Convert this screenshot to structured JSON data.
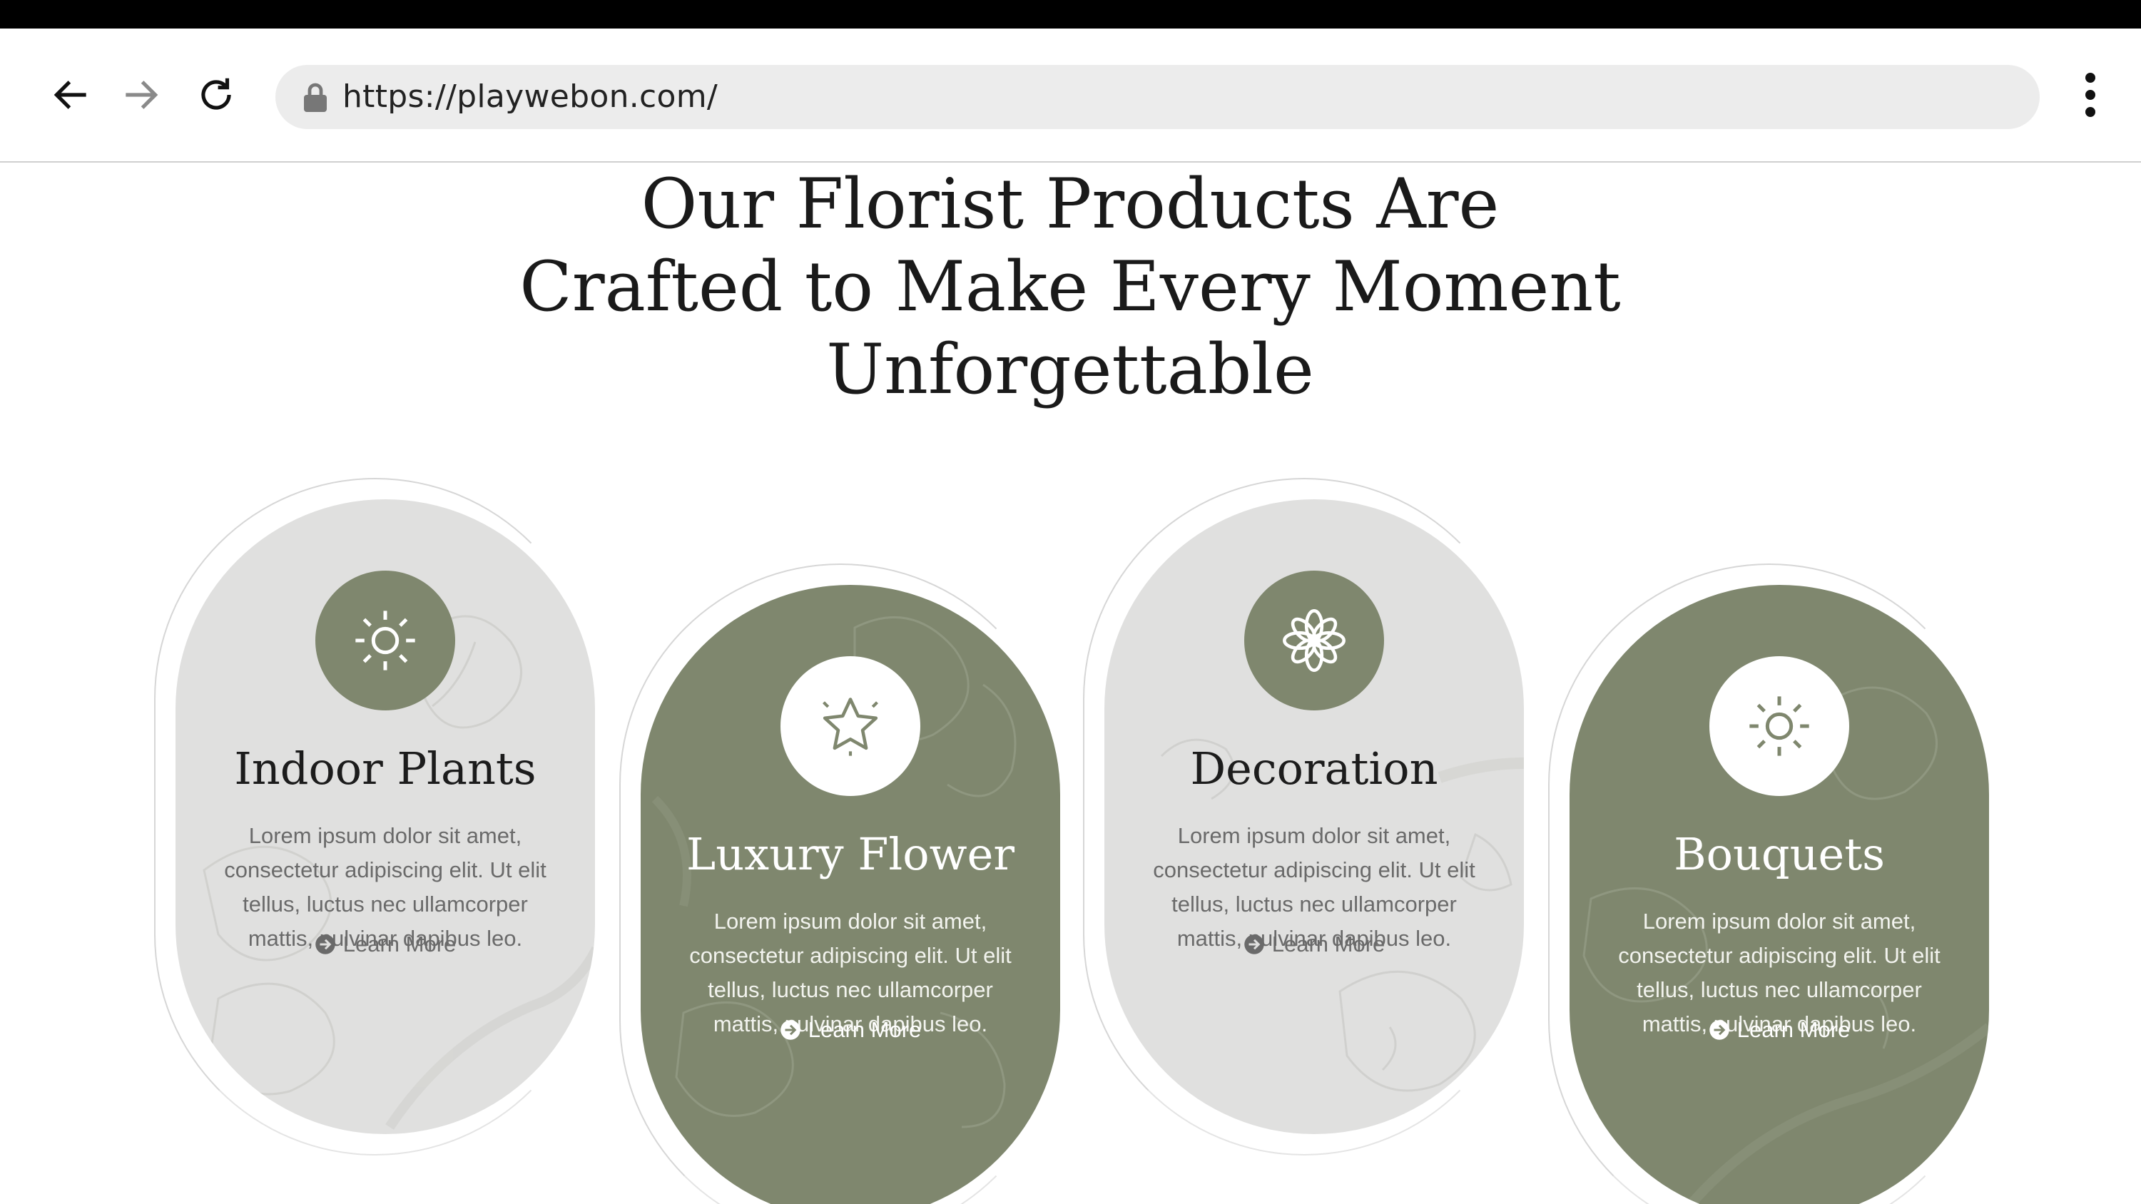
{
  "browser": {
    "url": "https://playwebon.com/",
    "icons": [
      "back-arrow-icon",
      "forward-arrow-icon",
      "reload-icon",
      "lock-icon",
      "more-vert-icon"
    ]
  },
  "section": {
    "headline": "Our Florist Products Are Crafted to Make Every Moment Unforgettable"
  },
  "cards": [
    {
      "title": "Indoor Plants",
      "text": "Lorem ipsum dolor sit amet, consectetur adipiscing elit. Ut elit tellus, luctus nec ullamcorper mattis, pulvinar dapibus leo.",
      "link": "Learn More",
      "icon": "sun-icon",
      "theme": "light"
    },
    {
      "title": "Luxury Flower",
      "text": "Lorem ipsum dolor sit amet, consectetur adipiscing elit. Ut elit tellus, luctus nec ullamcorper mattis, pulvinar dapibus leo.",
      "link": "Learn More",
      "icon": "star-icon",
      "theme": "dark"
    },
    {
      "title": "Decoration",
      "text": "Lorem ipsum dolor sit amet, consectetur adipiscing elit. Ut elit tellus, luctus nec ullamcorper mattis, pulvinar dapibus leo.",
      "link": "Learn More",
      "icon": "lotus-icon",
      "theme": "light"
    },
    {
      "title": "Bouquets",
      "text": "Lorem ipsum dolor sit amet, consectetur adipiscing elit. Ut elit tellus, luctus nec ullamcorper mattis, pulvinar dapibus leo.",
      "link": "Learn More",
      "icon": "sun-icon",
      "theme": "dark"
    }
  ],
  "colors": {
    "sage": "#7f876e",
    "light_pill": "#e0e0df",
    "headline": "#1a1a1a",
    "body_text": "#6a6a6a"
  }
}
